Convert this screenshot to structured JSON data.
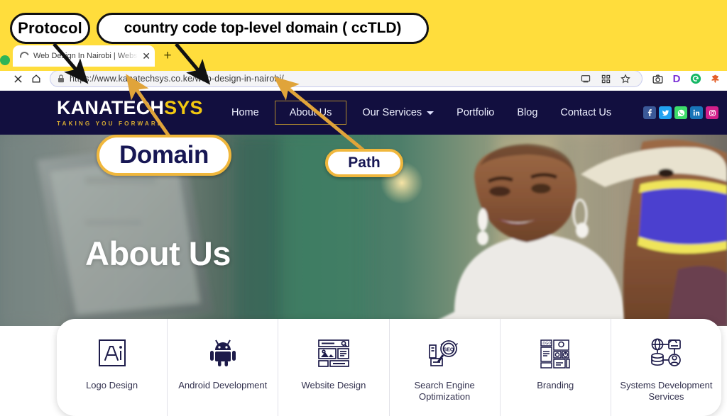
{
  "annotations": {
    "protocol": "Protocol",
    "cctld": "country code top-level domain ( ccTLD)",
    "domain": "Domain",
    "path": "Path",
    "arrow_dark_color": "#111111",
    "arrow_gold_color": "#e0a43a",
    "backdrop_color": "#ffdd3c"
  },
  "browser": {
    "tab": {
      "title": "Web Design In Nairobi | Websit",
      "close_label": "✕",
      "loading_icon": "spinner-icon"
    },
    "new_tab_label": "+",
    "toolbar": {
      "stop_icon": "close-icon",
      "home_icon": "home-icon",
      "lock_icon": "lock-icon",
      "url": "https://www.kanatechsys.co.ke/web-design-in-nairobi/",
      "cast_icon": "cast-icon",
      "qr_icon": "qr-code-icon",
      "bookmark_icon": "star-icon",
      "extensions": [
        {
          "name": "screenshot-extension",
          "label": "◉",
          "color": "#3b3b3b"
        },
        {
          "name": "d-extension",
          "label": "D",
          "color": "#7b31d6"
        },
        {
          "name": "g-extension",
          "label": "G",
          "color": "#16b765"
        },
        {
          "name": "leaf-extension",
          "label": "❀",
          "color": "#e4602a"
        }
      ]
    }
  },
  "site": {
    "logo": {
      "primary": "KANATECH",
      "accent": "SYS",
      "tagline": "TAKING YOU FORWARD",
      "primary_color": "#ffffff",
      "accent_color": "#f2c811"
    },
    "nav": [
      {
        "label": "Home",
        "active": false,
        "has_caret": false
      },
      {
        "label": "About Us",
        "active": true,
        "has_caret": false
      },
      {
        "label": "Our Services",
        "active": false,
        "has_caret": true
      },
      {
        "label": "Portfolio",
        "active": false,
        "has_caret": false
      },
      {
        "label": "Blog",
        "active": false,
        "has_caret": false
      },
      {
        "label": "Contact Us",
        "active": false,
        "has_caret": false
      }
    ],
    "socials": [
      {
        "name": "facebook-icon",
        "glyph": "f",
        "color": "#3b5998"
      },
      {
        "name": "twitter-icon",
        "glyph": "ᴠ",
        "color": "#21a2f1"
      },
      {
        "name": "whatsapp-icon",
        "glyph": "✆",
        "color": "#3ddc6b"
      },
      {
        "name": "linkedin-icon",
        "glyph": "in",
        "color": "#1874b8"
      },
      {
        "name": "instagram-icon",
        "glyph": "▢",
        "color": "#d21f8a"
      }
    ],
    "nav_bg": "#120f3f",
    "hero": {
      "title": "About Us"
    },
    "services": [
      {
        "label": "Logo Design",
        "icon": "adobe-illustrator-icon"
      },
      {
        "label": "Android Development",
        "icon": "android-icon"
      },
      {
        "label": "Website Design",
        "icon": "webpage-layout-icon"
      },
      {
        "label": "Search Engine Optimization",
        "icon": "seo-magnifier-icon"
      },
      {
        "label": "Branding",
        "icon": "branding-documents-icon"
      },
      {
        "label": "Systems Development Services",
        "icon": "systems-network-icon"
      }
    ]
  }
}
